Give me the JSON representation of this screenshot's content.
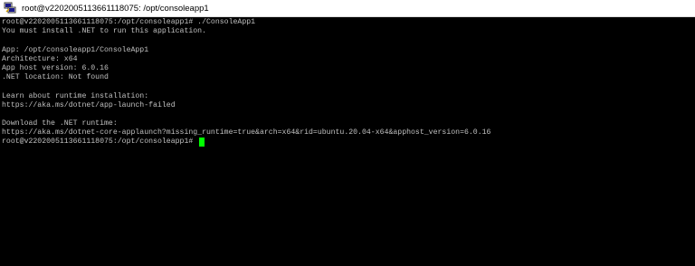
{
  "window": {
    "title": "root@v2202005113661118075: /opt/consoleapp1",
    "icon": "putty-terminal-icon"
  },
  "terminal": {
    "colors": {
      "background": "#000000",
      "foreground": "#c0c0c0",
      "cursor": "#00ff00"
    },
    "lines": [
      "root@v2202005113661118075:/opt/consoleapp1# ./ConsoleApp1",
      "You must install .NET to run this application.",
      "",
      "App: /opt/consoleapp1/ConsoleApp1",
      "Architecture: x64",
      "App host version: 6.0.16",
      ".NET location: Not found",
      "",
      "Learn about runtime installation:",
      "https://aka.ms/dotnet/app-launch-failed",
      "",
      "Download the .NET runtime:",
      "https://aka.ms/dotnet-core-applaunch?missing_runtime=true&arch=x64&rid=ubuntu.20.04-x64&apphost_version=6.0.16"
    ],
    "prompt": "root@v2202005113661118075:/opt/consoleapp1# "
  }
}
